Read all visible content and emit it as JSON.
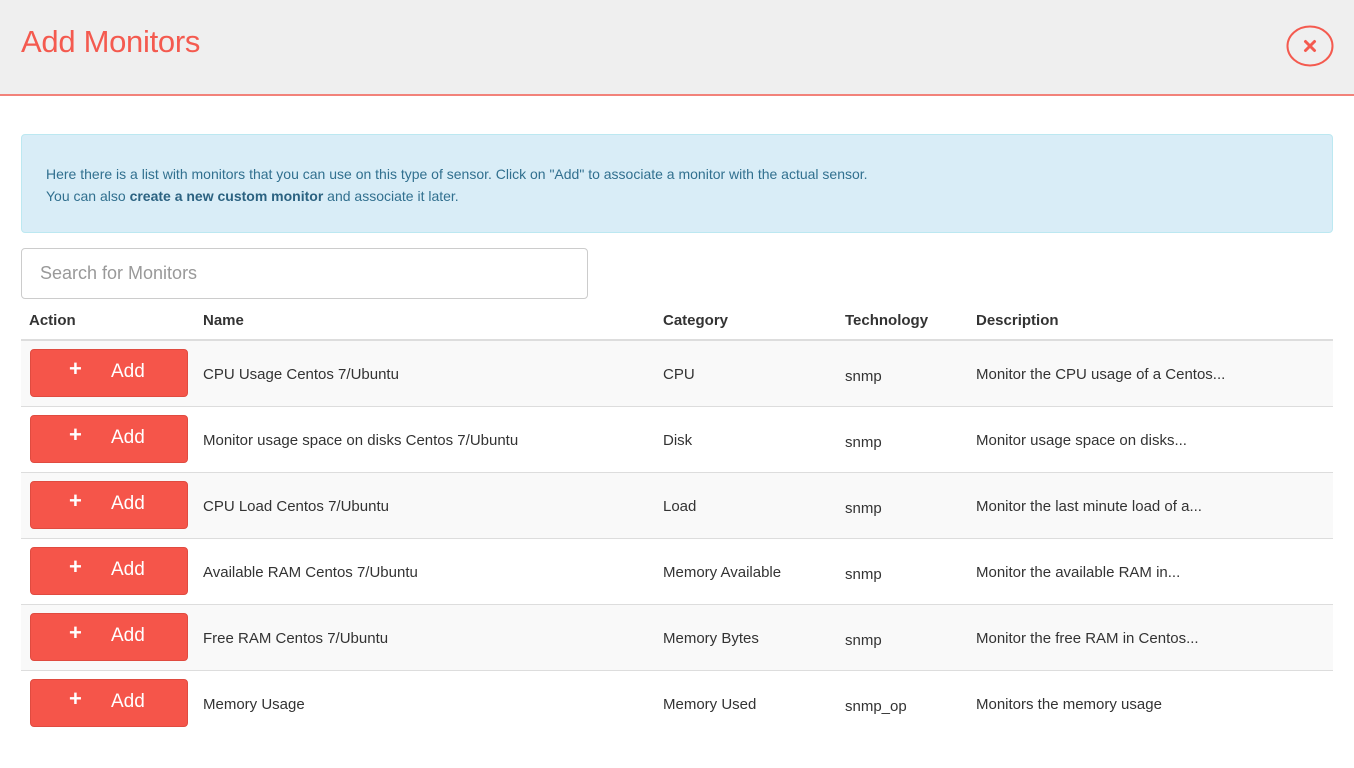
{
  "header": {
    "title": "Add Monitors",
    "close_icon": "close-circle-icon",
    "accent_color": "#f45a4f"
  },
  "info": {
    "line1": "Here there is a list with monitors that you can use on this type of sensor. Click on \"Add\" to associate a monitor with the actual sensor.",
    "line2_prefix": "You can also ",
    "line2_bold": "create a new custom monitor",
    "line2_suffix": " and associate it later."
  },
  "search": {
    "placeholder": "Search for Monitors",
    "value": ""
  },
  "table": {
    "headers": {
      "action": "Action",
      "name": "Name",
      "category": "Category",
      "technology": "Technology",
      "description": "Description"
    },
    "add_label": "Add",
    "add_icon": "plus-icon",
    "rows": [
      {
        "name": "CPU Usage Centos 7/Ubuntu",
        "category": "CPU",
        "technology": "snmp",
        "description": "Monitor the CPU usage of a Centos..."
      },
      {
        "name": "Monitor usage space on disks Centos 7/Ubuntu",
        "category": "Disk",
        "technology": "snmp",
        "description": "Monitor usage space on disks..."
      },
      {
        "name": "CPU Load Centos 7/Ubuntu",
        "category": "Load",
        "technology": "snmp",
        "description": "Monitor the last minute load of a..."
      },
      {
        "name": "Available RAM Centos 7/Ubuntu",
        "category": "Memory Available",
        "technology": "snmp",
        "description": "Monitor the available RAM in..."
      },
      {
        "name": "Free RAM Centos 7/Ubuntu",
        "category": "Memory Bytes",
        "technology": "snmp",
        "description": "Monitor the free RAM in Centos..."
      },
      {
        "name": "Memory Usage",
        "category": "Memory Used",
        "technology": "snmp_op",
        "description": "Monitors the memory usage"
      }
    ]
  }
}
